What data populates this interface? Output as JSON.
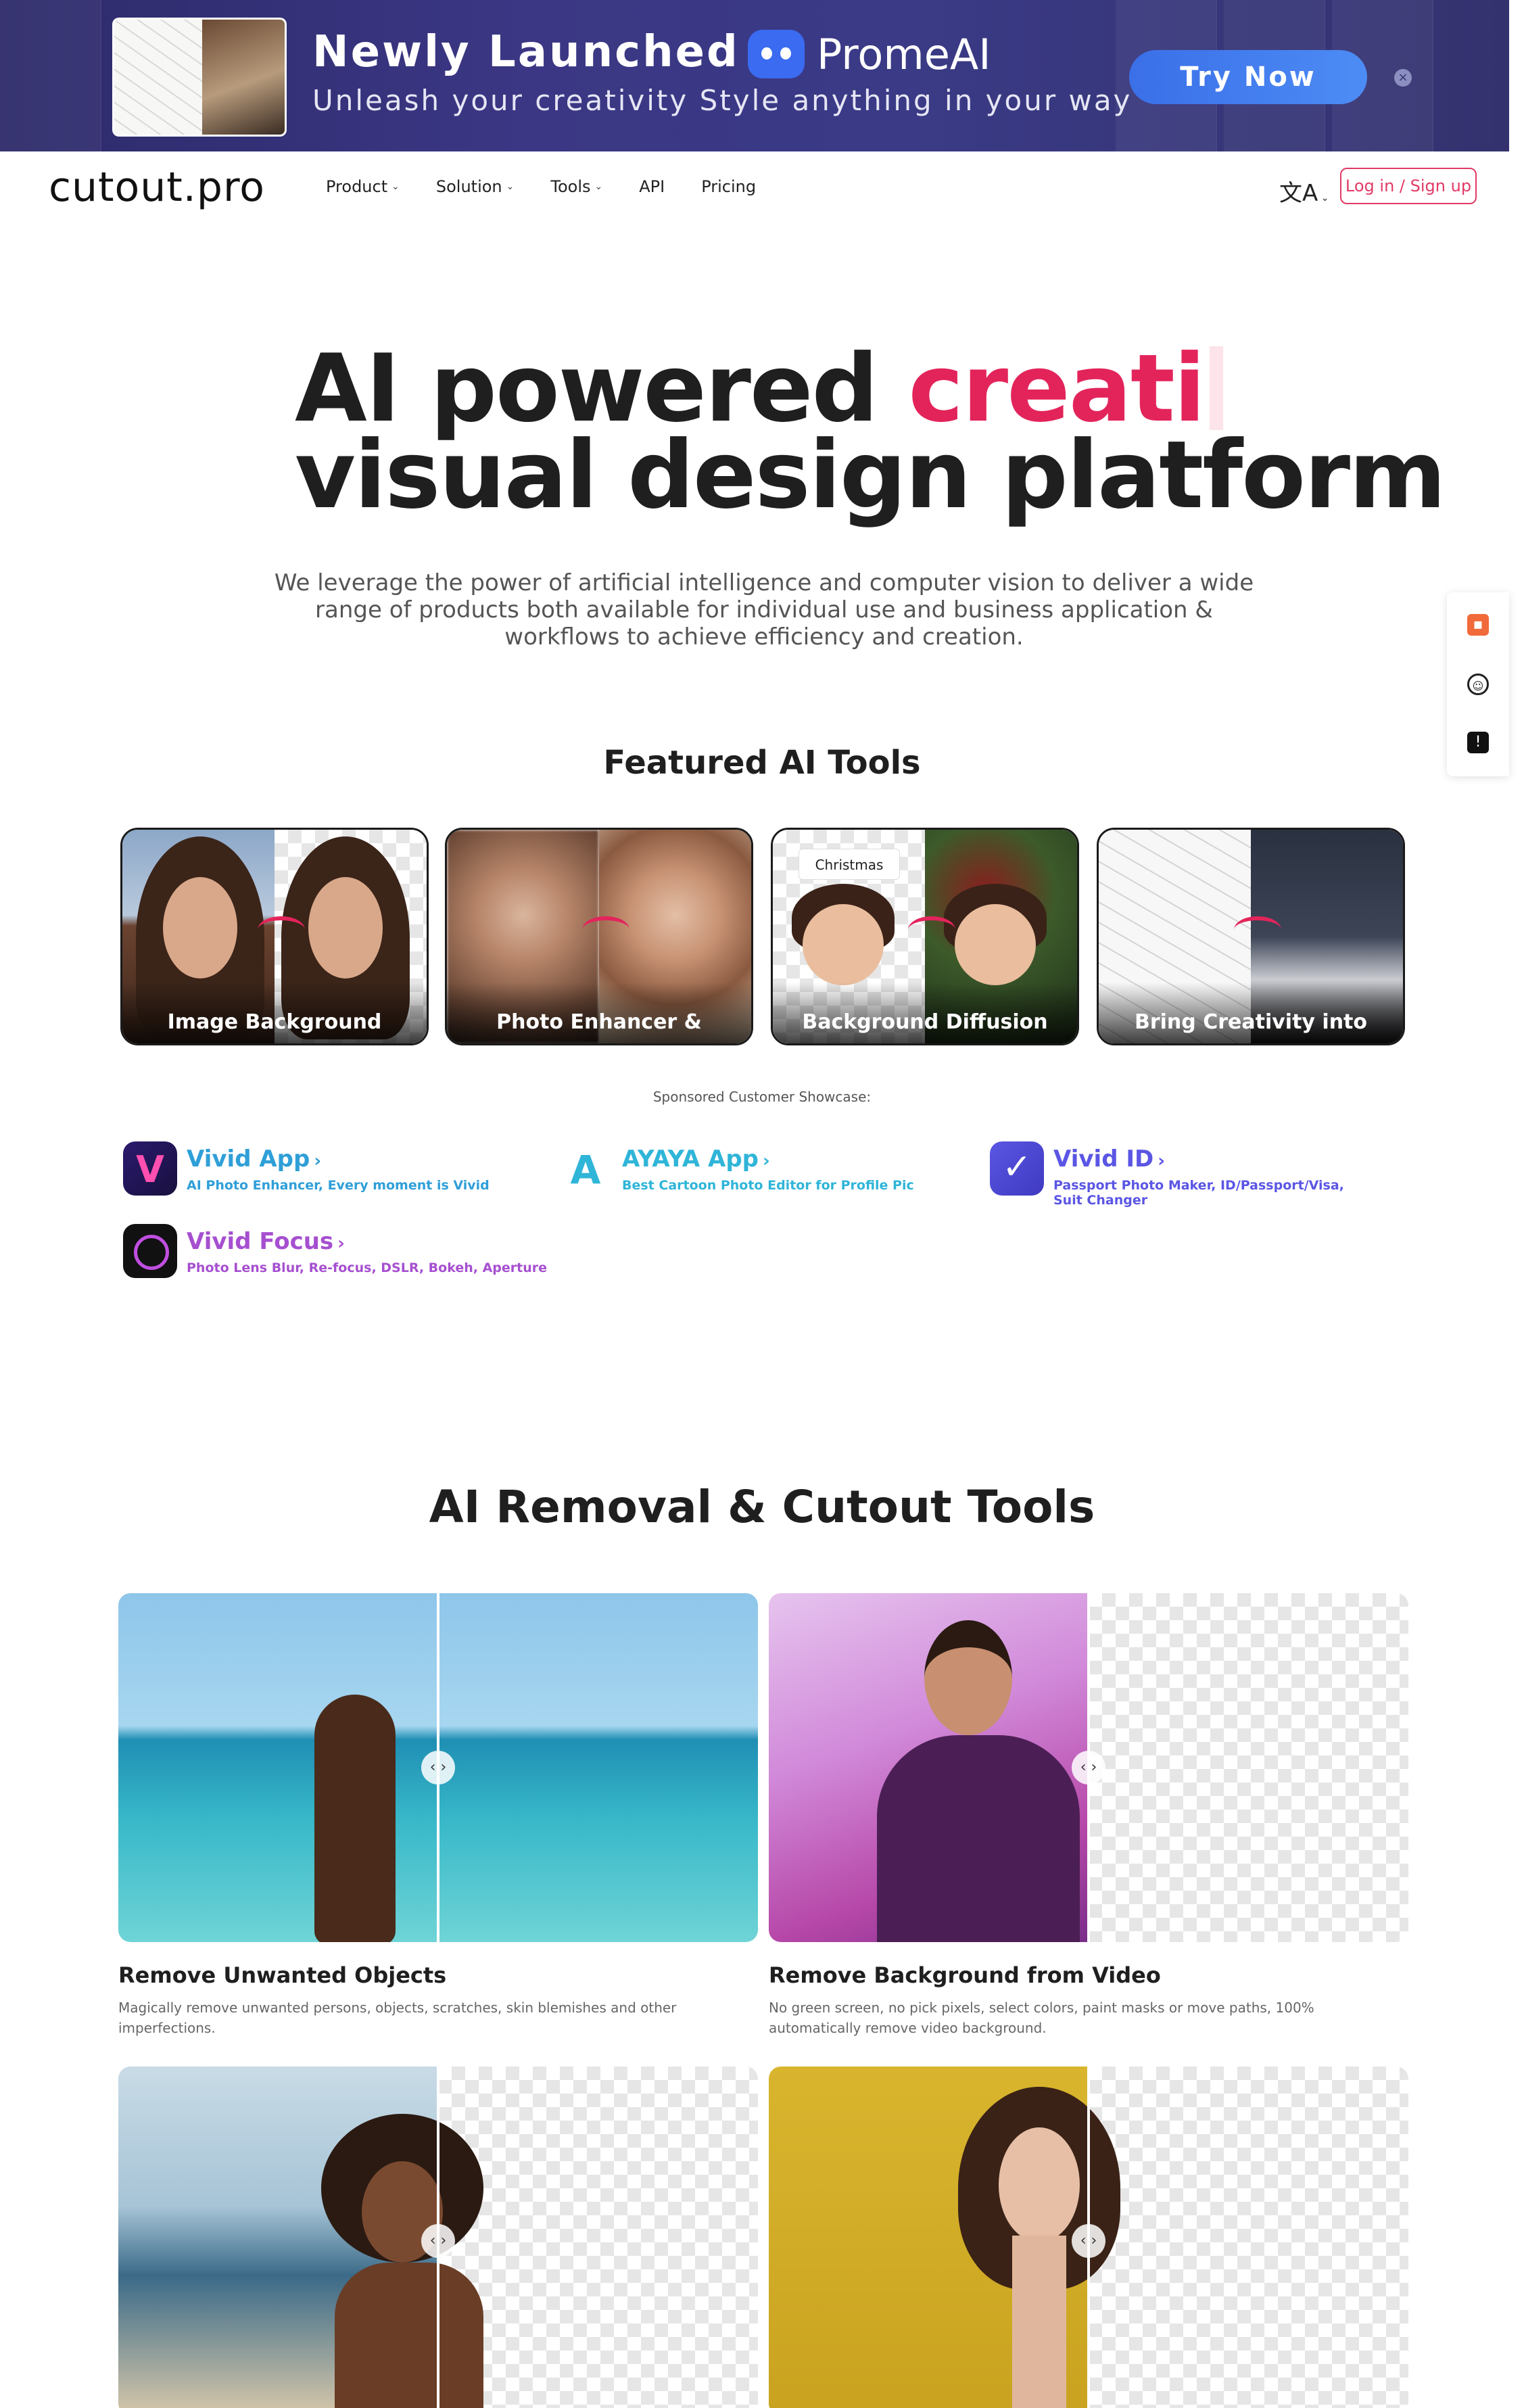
{
  "banner": {
    "title": "Newly Launched",
    "subtitle": "Unleash your creativity Style anything in your way",
    "brand": "PromeAI",
    "cta": "Try Now",
    "close": "×"
  },
  "nav": {
    "logo": "cutout.pro",
    "links": [
      {
        "label": "Product",
        "has_dropdown": true
      },
      {
        "label": "Solution",
        "has_dropdown": true
      },
      {
        "label": "Tools",
        "has_dropdown": true
      },
      {
        "label": "API",
        "has_dropdown": false
      },
      {
        "label": "Pricing",
        "has_dropdown": false
      }
    ],
    "language_icon": "translate-icon",
    "login": "Log in / Sign up"
  },
  "hero": {
    "line1_prefix": "AI powered ",
    "line1_accent": "creati",
    "line2": "visual design platform",
    "description": "We leverage the power of artificial intelligence and computer vision to deliver a wide range of products both available for individual use and business application & workflows to achieve efficiency and creation."
  },
  "featured": {
    "title": "Featured AI Tools",
    "cards": [
      {
        "label": "Image Background Removal"
      },
      {
        "label": "Photo Enhancer & Upscaler"
      },
      {
        "label": "Background Diffusion",
        "tag": "Christmas",
        "plus": "+"
      },
      {
        "label": "Bring Creativity into Reality"
      }
    ]
  },
  "sponsored": {
    "label": "Sponsored Customer Showcase:",
    "apps": [
      {
        "name": "Vivid App",
        "desc": "AI Photo Enhancer, Every moment is Vivid",
        "color": "#2f9fd8"
      },
      {
        "name": "AYAYA App",
        "desc": "Best Cartoon Photo Editor for Profile Pic",
        "color": "#2fb5d8"
      },
      {
        "name": "Vivid ID",
        "desc": "Passport Photo Maker, ID/Passport/Visa, Suit Changer",
        "color": "#5b56e4"
      },
      {
        "name": "Vivid Focus",
        "desc": "Photo Lens Blur, Re-focus, DSLR, Bokeh, Aperture",
        "color": "#a64fd0"
      }
    ]
  },
  "removal": {
    "title": "AI Removal & Cutout Tools",
    "tools": [
      {
        "title": "Remove Unwanted Objects",
        "desc": "Magically remove unwanted persons, objects, scratches, skin blemishes and other imperfections."
      },
      {
        "title": "Remove Background from Video",
        "desc": "No green screen, no pick pixels, select colors, paint masks or move paths, 100% automatically remove video background."
      }
    ]
  },
  "slider_knob": "‹ ›",
  "colors": {
    "accent": "#e3245b",
    "banner_bg": "#3b3784",
    "cta": "#4d8cf5"
  }
}
